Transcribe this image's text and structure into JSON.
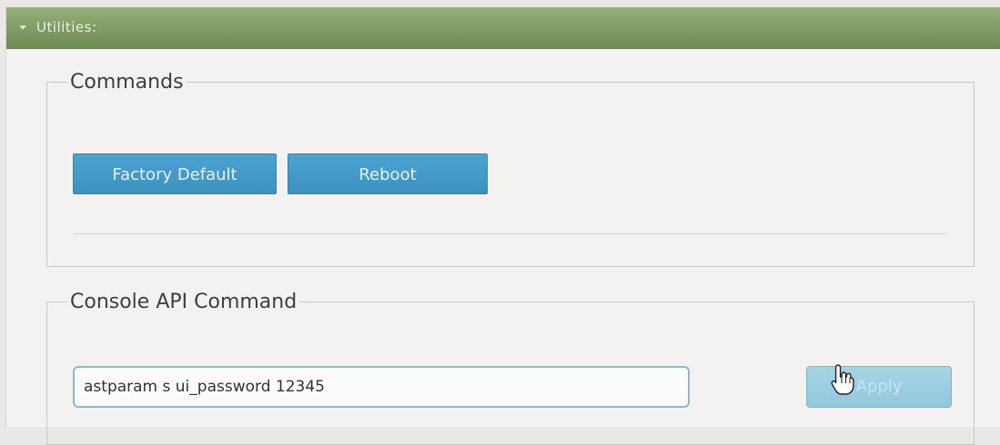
{
  "panel": {
    "title": "Utilities:"
  },
  "commands": {
    "legend": "Commands",
    "factory_default_label": "Factory Default",
    "reboot_label": "Reboot"
  },
  "console": {
    "legend": "Console API Command",
    "input_value": "astparam s ui_password 12345",
    "apply_label": "Apply"
  },
  "colors": {
    "header_green": "#7f9a63",
    "button_blue": "#3b92c0",
    "apply_disabled_blue": "#a6d4e4"
  },
  "icons": {
    "header_toggle": "triangle-down-icon",
    "cursor": "hand-pointer-icon"
  }
}
